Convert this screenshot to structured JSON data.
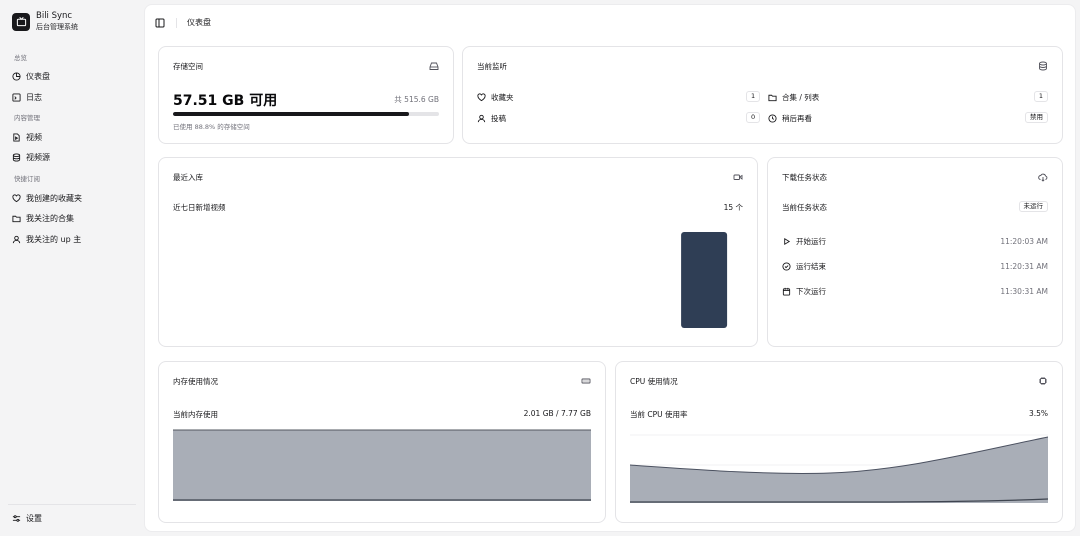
{
  "brand": {
    "name": "Bili Sync",
    "subtitle": "后台管理系统"
  },
  "sidebar": {
    "groups": [
      {
        "label": "总览",
        "items": [
          {
            "label": "仪表盘",
            "icon": "pie-chart-icon"
          },
          {
            "label": "日志",
            "icon": "terminal-icon"
          }
        ]
      },
      {
        "label": "内容管理",
        "items": [
          {
            "label": "视频",
            "icon": "file-video-icon"
          },
          {
            "label": "视频源",
            "icon": "database-icon"
          }
        ]
      },
      {
        "label": "快捷订阅",
        "items": [
          {
            "label": "我创建的收藏夹",
            "icon": "heart-icon"
          },
          {
            "label": "我关注的合集",
            "icon": "folder-icon"
          },
          {
            "label": "我关注的 up 主",
            "icon": "user-icon"
          }
        ]
      }
    ],
    "footer": {
      "label": "设置",
      "icon": "sliders-icon"
    }
  },
  "topbar": {
    "breadcrumb": "仪表盘"
  },
  "storage": {
    "title": "存储空间",
    "available": "57.51 GB 可用",
    "total": "共 515.6 GB",
    "used_percent": 88.8,
    "used_text": "已使用 88.8% 的存储空间"
  },
  "monitoring": {
    "title": "当前监听",
    "items": [
      {
        "label": "收藏夹",
        "value": "1",
        "icon": "heart-icon"
      },
      {
        "label": "合集 / 列表",
        "value": "1",
        "icon": "folder-icon"
      },
      {
        "label": "投稿",
        "value": "0",
        "icon": "user-icon"
      },
      {
        "label": "稍后再看",
        "value": "禁用",
        "icon": "clock-icon"
      }
    ]
  },
  "recent": {
    "title": "最近入库",
    "label": "近七日新增视频",
    "value": "15 个",
    "bar_values": [
      0,
      0,
      0,
      0,
      0,
      0,
      15
    ]
  },
  "download": {
    "title": "下载任务状态",
    "status_label": "当前任务状态",
    "status": "未运行",
    "rows": [
      {
        "label": "开始运行",
        "time": "11:20:03 AM",
        "icon": "play-icon"
      },
      {
        "label": "运行结束",
        "time": "11:20:31 AM",
        "icon": "check-circle-icon"
      },
      {
        "label": "下次运行",
        "time": "11:30:31 AM",
        "icon": "calendar-icon"
      }
    ]
  },
  "memory": {
    "title": "内存使用情况",
    "label": "当前内存使用",
    "value": "2.01 GB / 7.77 GB"
  },
  "cpu": {
    "title": "CPU 使用情况",
    "label": "当前 CPU 使用率",
    "value": "3.5%"
  }
}
